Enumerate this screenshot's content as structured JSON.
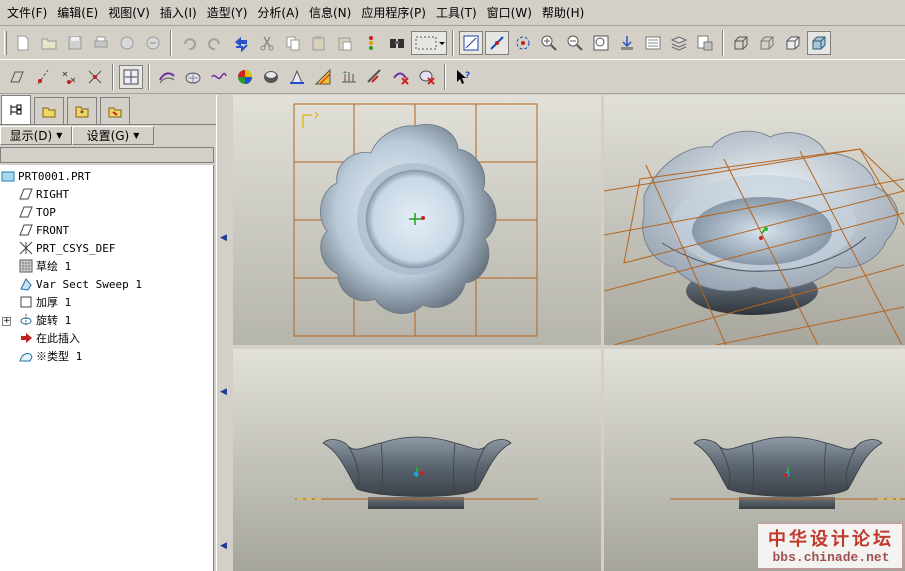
{
  "menu": [
    "文件(F)",
    "编辑(E)",
    "视图(V)",
    "插入(I)",
    "造型(Y)",
    "分析(A)",
    "信息(N)",
    "应用程序(P)",
    "工具(T)",
    "窗口(W)",
    "帮助(H)"
  ],
  "toolbar_icons": {
    "row1": [
      "new-file-icon",
      "open-folder-icon",
      "save-icon",
      "print-icon",
      "save-copy-icon",
      "erase-icon",
      "undo-icon",
      "redo-icon",
      "regenerate-icon",
      "cut-icon",
      "copy-icon",
      "paste-icon",
      "paste-special-icon",
      "model-player-icon",
      "find-icon",
      "selection-filter-icon",
      "refit-icon",
      "datum-axis-icon",
      "spin-center-icon",
      "zoom-in-icon",
      "zoom-out-icon",
      "zoom-window-icon",
      "orient-icon",
      "saved-views-icon",
      "layers-icon",
      "view-manager-icon",
      "wireframe-icon",
      "hidden-line-icon",
      "no-hidden-icon",
      "shading-icon"
    ],
    "row2": [
      "datum-plane-icon",
      "datum-axis-tool-icon",
      "datum-point-icon",
      "coordinate-system-icon",
      "sketch-icon",
      "style-icon",
      "surface-icon",
      "curve-icon",
      "color-icon",
      "appearance-icon",
      "transform-icon",
      "pattern-icon",
      "mirror-icon",
      "trim-icon",
      "delete-icon",
      "context-help-icon"
    ]
  },
  "left_panel": {
    "display_label": "显示(D)",
    "settings_label": "设置(G)",
    "tree": [
      {
        "label": "PRT0001.PRT",
        "icon": "part-icon"
      },
      {
        "label": "RIGHT",
        "icon": "datum-plane-icon"
      },
      {
        "label": "TOP",
        "icon": "datum-plane-icon"
      },
      {
        "label": "FRONT",
        "icon": "datum-plane-icon"
      },
      {
        "label": "PRT_CSYS_DEF",
        "icon": "csys-icon"
      },
      {
        "label": "草绘 1",
        "icon": "sketch-icon"
      },
      {
        "label": "Var Sect Sweep 1",
        "icon": "sweep-icon"
      },
      {
        "label": "加厚 1",
        "icon": "thicken-icon"
      },
      {
        "label": "旋转 1",
        "icon": "revolve-icon",
        "expander": "+"
      },
      {
        "label": "在此插入",
        "icon": "insert-here-arrow-icon"
      },
      {
        "label": "※类型 1",
        "icon": "style-feature-icon"
      }
    ]
  },
  "viewports": {
    "top_left": "top-view-bowl",
    "top_right": "iso-view-bowl",
    "bottom_left": "front-view-bowl",
    "bottom_right": "side-view-bowl"
  },
  "colors": {
    "chrome": "#d4d0c8",
    "viewport_bg_top": "#e2e1d9",
    "viewport_bg_bottom": "#a6a59c",
    "grid_line": "#b5651d",
    "bowl_light": "#dce7f0",
    "bowl_dark": "#4a5058"
  },
  "watermark": {
    "line1": "中华设计论坛",
    "line2": "bbs.chinade.net"
  }
}
